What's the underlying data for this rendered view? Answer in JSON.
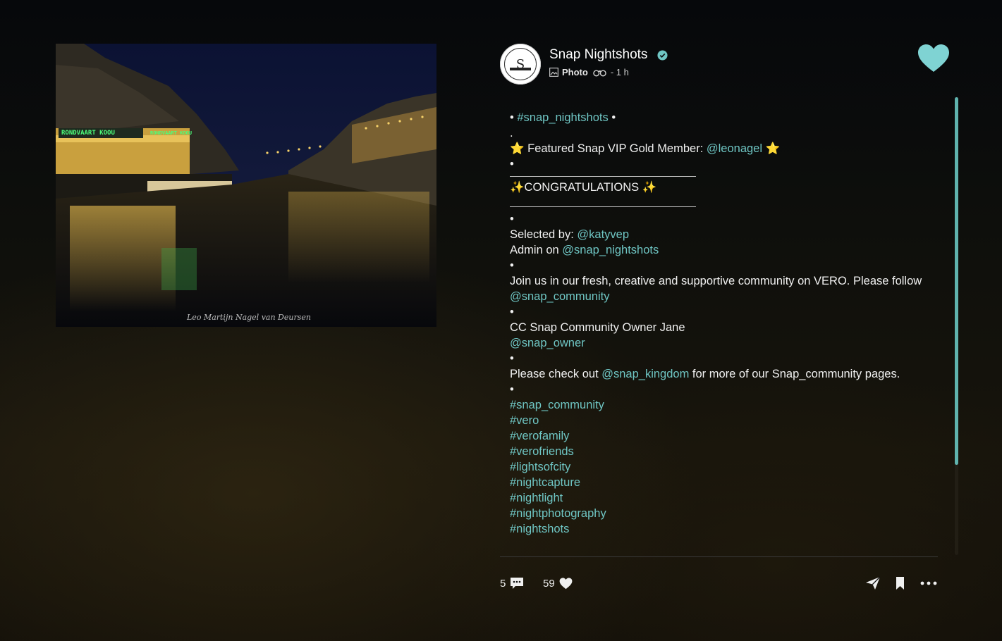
{
  "post": {
    "account_name": "Snap Nightshots",
    "avatar_letter": "S",
    "type_label": "Photo",
    "time": "- 1 h",
    "photo_watermark": "Leo Martijn Nagel van Deursen",
    "photo_signs": [
      "RONDVAART KOOU",
      "RONDVAART KOOU"
    ]
  },
  "caption": {
    "hashtag_top": "#snap_nightshots",
    "featured_prefix": "⭐ Featured Snap VIP Gold Member: ",
    "featured_user": "@leonagel",
    "featured_suffix": " ⭐",
    "congrats": "✨CONGRATULATIONS ✨",
    "selected_by_label": "Selected by: ",
    "selected_by_user": "@katyvep",
    "admin_label": "Admin on ",
    "admin_user": "@snap_nightshots",
    "join_text": "Join us in our fresh, creative and supportive community on VERO. Please follow ",
    "join_user": "@snap_community",
    "cc_text": "CC Snap Community Owner Jane",
    "cc_user": "@snap_owner",
    "check_prefix": "Please check out ",
    "check_user": "@snap_kingdom",
    "check_suffix": " for more of our Snap_community pages.",
    "hashtags": [
      "#snap_community",
      "#vero",
      "#verofamily",
      "#verofriends",
      "#lightsofcity",
      "#nightcapture",
      "#nightlight",
      "#nightphotography",
      "#nightshots"
    ]
  },
  "footer": {
    "comment_count": "5",
    "like_count": "59"
  },
  "colors": {
    "accent": "#6fc6c4",
    "heart": "#7fd3d3",
    "scroll_thumb": "#5fb3ae"
  },
  "icons": [
    "verified-badge-icon",
    "photo-icon",
    "binoculars-icon",
    "heart-icon",
    "comment-icon",
    "like-heart-icon",
    "share-icon",
    "bookmark-icon",
    "more-icon"
  ]
}
